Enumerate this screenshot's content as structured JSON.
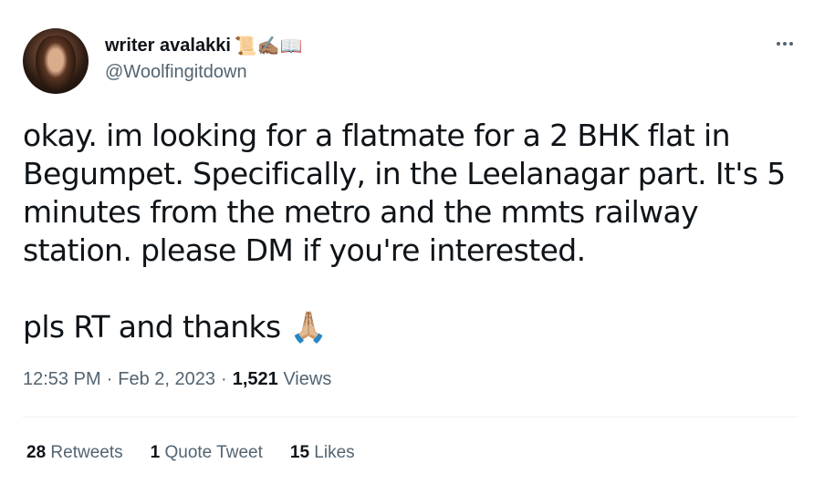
{
  "author": {
    "display_name": "writer avalakki",
    "name_emojis": "📜✍🏽📖",
    "handle": "@Woolfingitdown"
  },
  "tweet": {
    "text": "okay. im looking for a flatmate for a 2 BHK flat in Begumpet. Specifically, in the Leelanagar part. It's 5 minutes from the metro and the mmts railway station. please DM if you're interested.\n\npls RT and thanks 🙏🏼",
    "time": "12:53 PM",
    "date": "Feb 2, 2023",
    "views_count": "1,521",
    "views_label": "Views"
  },
  "stats": {
    "retweets_count": "28",
    "retweets_label": "Retweets",
    "quotes_count": "1",
    "quotes_label": "Quote Tweet",
    "likes_count": "15",
    "likes_label": "Likes"
  },
  "icons": {
    "more": "more-options-icon"
  },
  "colors": {
    "text_primary": "#0f1419",
    "text_secondary": "#536471",
    "divider": "#eff3f4"
  }
}
